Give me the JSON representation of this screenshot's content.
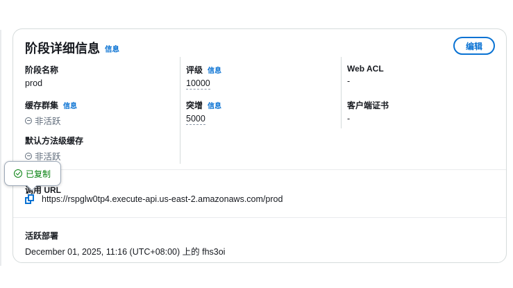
{
  "header": {
    "title": "阶段详细信息",
    "info": "信息",
    "edit": "编辑"
  },
  "fields": {
    "stage_name": {
      "label": "阶段名称",
      "value": "prod"
    },
    "rate": {
      "label": "评级",
      "info": "信息",
      "value": "10000"
    },
    "web_acl": {
      "label": "Web ACL",
      "value": "-"
    },
    "cache_cluster": {
      "label": "缓存群集",
      "info": "信息",
      "value": "非活跃"
    },
    "burst": {
      "label": "突增",
      "info": "信息",
      "value": "5000"
    },
    "client_cert": {
      "label": "客户端证书",
      "value": "-"
    },
    "method_cache": {
      "label": "默认方法级缓存",
      "value": "非活跃"
    }
  },
  "invoke": {
    "label": "调用 URL",
    "url": "https://rspglw0tp4.execute-api.us-east-2.amazonaws.com/prod",
    "copied": "已复制"
  },
  "deployment": {
    "label": "活跃部署",
    "value": "December 01, 2025, 11:16 (UTC+08:00) 上的 fhs3oi"
  },
  "colors": {
    "accent": "#0972d3",
    "success": "#037f0c",
    "muted": "#5f6b7a"
  }
}
